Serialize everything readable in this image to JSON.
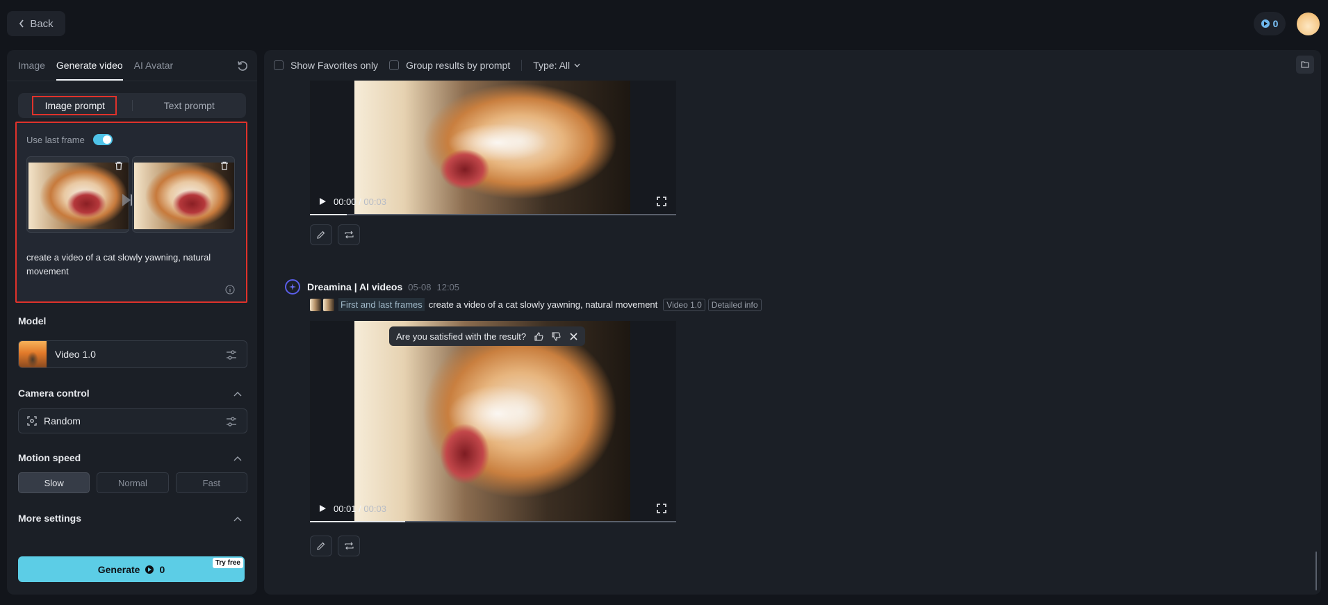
{
  "topbar": {
    "back_label": "Back",
    "credits": "0"
  },
  "left": {
    "tabs": [
      {
        "label": "Image",
        "active": false
      },
      {
        "label": "Generate video",
        "active": true
      },
      {
        "label": "AI Avatar",
        "active": false
      }
    ],
    "prompt_modes": {
      "image": "Image prompt",
      "text": "Text prompt"
    },
    "use_last_frame": {
      "label": "Use last frame",
      "enabled": true
    },
    "prompt_text": "create a video of a cat slowly yawning, natural movement",
    "model": {
      "section_title": "Model",
      "value": "Video 1.0"
    },
    "camera": {
      "section_title": "Camera control",
      "value": "Random"
    },
    "motion": {
      "section_title": "Motion speed",
      "options": [
        "Slow",
        "Normal",
        "Fast"
      ],
      "selected": "Slow"
    },
    "more_settings": {
      "section_title": "More settings"
    },
    "generate": {
      "label": "Generate",
      "cost": "0",
      "badge": "Try free"
    }
  },
  "main": {
    "filters": {
      "favorites": "Show Favorites only",
      "group": "Group results by prompt",
      "type": "Type: All"
    },
    "videos": [
      {
        "current": "00:00",
        "duration": "00:03",
        "progress": 0.1
      },
      {
        "current": "00:01",
        "duration": "00:03",
        "progress": 0.26
      }
    ],
    "result": {
      "author": "Dreamina | AI videos",
      "date": "05-08",
      "time": "12:05",
      "mode_tag": "First and last frames",
      "prompt": "create a video of a cat slowly yawning, natural movement",
      "model_tag": "Video 1.0",
      "info_tag": "Detailed info",
      "feedback_question": "Are you satisfied with the result?"
    }
  },
  "colors": {
    "accent": "#5ccde6",
    "highlight_outline": "#e0322b",
    "background": "#12151b",
    "panel": "#1b1f26"
  }
}
